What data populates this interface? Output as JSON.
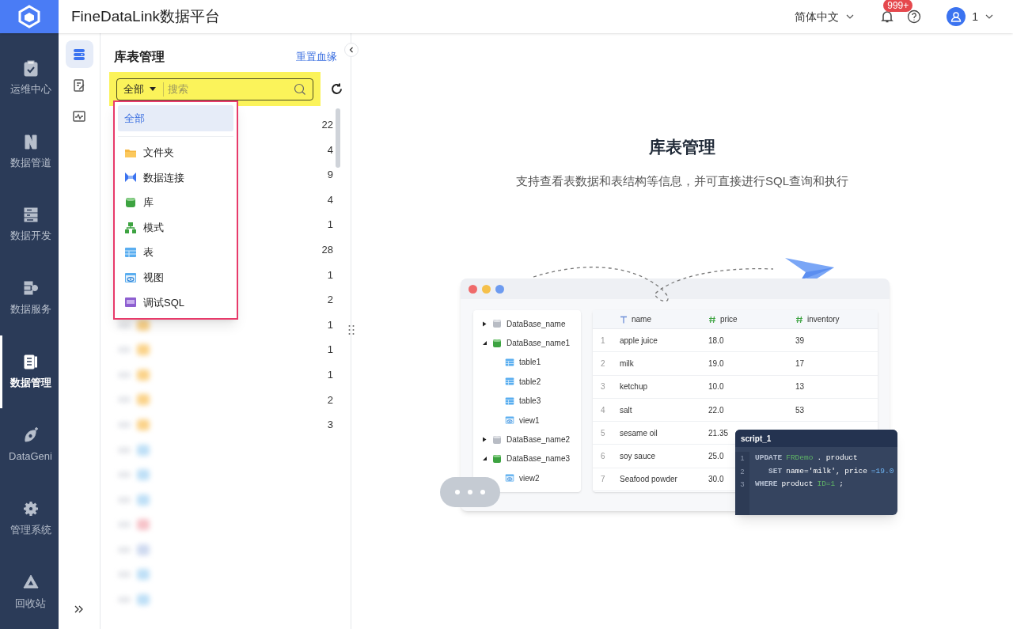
{
  "header": {
    "title": "FineDataLink数据平台",
    "language": "简体中文",
    "notification_badge": "999+",
    "user": "1"
  },
  "nav": [
    {
      "label": "运维中心",
      "kind": "ops",
      "selected": false
    },
    {
      "label": "数据管道",
      "kind": "pipeline",
      "selected": false
    },
    {
      "label": "数据开发",
      "kind": "dev",
      "selected": false
    },
    {
      "label": "数据服务",
      "kind": "service",
      "selected": false
    },
    {
      "label": "数据管理",
      "kind": "manage",
      "selected": true
    },
    {
      "label": "DataGeni",
      "kind": "ai",
      "selected": false
    },
    {
      "label": "管理系统",
      "kind": "gear",
      "selected": false
    },
    {
      "label": "回收站",
      "kind": "recycle",
      "selected": false
    }
  ],
  "subnav": [
    {
      "kind": "database",
      "selected": true
    },
    {
      "kind": "edit",
      "selected": false
    },
    {
      "kind": "monitor",
      "selected": false
    }
  ],
  "panel": {
    "title": "库表管理",
    "reset_link": "重置血缘",
    "filter": {
      "value": "全部",
      "placeholder": "搜索"
    },
    "dropdown": [
      {
        "label": "全部",
        "kind": "all",
        "selected": true
      },
      {
        "label": "文件夹",
        "kind": "folder",
        "selected": false
      },
      {
        "label": "数据连接",
        "kind": "connection",
        "selected": false
      },
      {
        "label": "库",
        "kind": "database",
        "selected": false
      },
      {
        "label": "模式",
        "kind": "schema",
        "selected": false
      },
      {
        "label": "表",
        "kind": "table",
        "selected": false
      },
      {
        "label": "视图",
        "kind": "view",
        "selected": false
      },
      {
        "label": "调试SQL",
        "kind": "sql",
        "selected": false
      }
    ],
    "rows": [
      {
        "kind": "folder",
        "count": "22"
      },
      {
        "kind": "folder",
        "count": "4"
      },
      {
        "kind": "folder",
        "count": "9"
      },
      {
        "kind": "folder",
        "count": "4"
      },
      {
        "kind": "folder",
        "count": "1"
      },
      {
        "kind": "folder",
        "count": "28"
      },
      {
        "kind": "folder",
        "count": "1"
      },
      {
        "kind": "folder",
        "count": "2"
      },
      {
        "kind": "folder",
        "count": "1"
      },
      {
        "kind": "folder",
        "count": "1"
      },
      {
        "kind": "folder",
        "count": "1"
      },
      {
        "kind": "folder",
        "count": "2"
      },
      {
        "kind": "folder",
        "count": "3"
      },
      {
        "kind": "table"
      },
      {
        "kind": "table"
      },
      {
        "kind": "table"
      },
      {
        "kind": "error"
      },
      {
        "kind": "connection"
      },
      {
        "kind": "table"
      },
      {
        "kind": "table"
      }
    ]
  },
  "intro": {
    "title": "库表管理",
    "description": "支持查看表数据和表结构等信息，并可直接进行SQL查询和执行"
  },
  "illustration": {
    "tree": [
      {
        "label": "DataBase_name",
        "expanded": false
      },
      {
        "label": "DataBase_name1",
        "expanded": true,
        "children": [
          {
            "label": "table1",
            "kind": "table"
          },
          {
            "label": "table2",
            "kind": "table"
          },
          {
            "label": "table3",
            "kind": "table"
          },
          {
            "label": "view1",
            "kind": "view"
          }
        ]
      },
      {
        "label": "DataBase_name2",
        "expanded": false
      },
      {
        "label": "DataBase_name3",
        "expanded": true,
        "children": [
          {
            "label": "view2",
            "kind": "view"
          }
        ]
      }
    ],
    "table": {
      "columns": [
        {
          "label": "name",
          "kind": "text"
        },
        {
          "label": "price",
          "kind": "number"
        },
        {
          "label": "inventory",
          "kind": "number"
        }
      ],
      "rows": [
        {
          "number": "1",
          "cells": [
            "apple juice",
            "18.0",
            "39"
          ]
        },
        {
          "number": "2",
          "cells": [
            "milk",
            "19.0",
            "17"
          ]
        },
        {
          "number": "3",
          "cells": [
            "ketchup",
            "10.0",
            "13"
          ]
        },
        {
          "number": "4",
          "cells": [
            "salt",
            "22.0",
            "53"
          ]
        },
        {
          "number": "5",
          "cells": [
            "sesame oil",
            "21.35"
          ]
        },
        {
          "number": "6",
          "cells": [
            "soy sauce",
            "25.0"
          ]
        },
        {
          "number": "7",
          "cells": [
            "Seafood powder",
            "30.0"
          ]
        }
      ]
    },
    "script": {
      "title": "script_1",
      "lines": [
        {
          "number": "1",
          "tokens": [
            {
              "kind": "keyword",
              "text": "UPDATE"
            },
            {
              "kind": "schema",
              "text": "FRDemo"
            },
            {
              "kind": "plain",
              "text": ". product"
            }
          ]
        },
        {
          "number": "2",
          "tokens": [
            {
              "kind": "keyword",
              "text": "   SET"
            },
            {
              "kind": "plain",
              "text": "name='milk', price"
            },
            {
              "kind": "value",
              "text": "=19.0"
            }
          ]
        },
        {
          "number": "3",
          "tokens": [
            {
              "kind": "keyword",
              "text": "WHERE"
            },
            {
              "kind": "plain",
              "text": "product"
            },
            {
              "kind": "schema",
              "text": "ID=1"
            },
            {
              "kind": "plain",
              "text": ";"
            }
          ]
        }
      ]
    }
  }
}
